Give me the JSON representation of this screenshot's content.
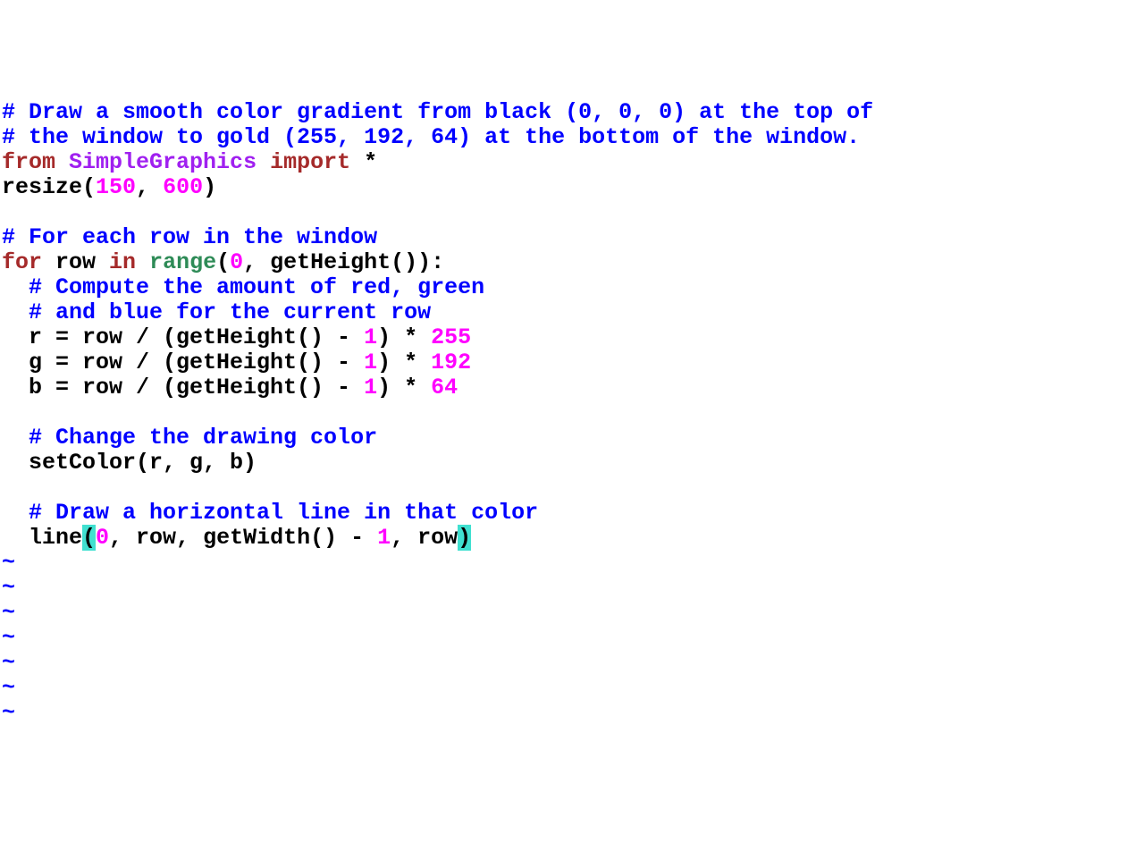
{
  "code": {
    "c1a": "# Draw a smooth color gradient from black (0, 0, 0) at the top of",
    "c1b": "# the window to gold (255, 192, 64) at the bottom of the window.",
    "kw_from": "from",
    "sp": " ",
    "mod": "SimpleGraphics",
    "kw_import": "import",
    "star": " *",
    "resize_txt": "resize(",
    "n150": "150",
    "comma_sp": ", ",
    "n600": "600",
    "close_p": ")",
    "blank": "",
    "c2": "# For each row in the window",
    "kw_for": "for",
    "row_sp": " row ",
    "kw_in": "in",
    "range_txt": "range",
    "open_p": "(",
    "n0": "0",
    "gh_close_colon": ", getHeight()):",
    "c3a": "  # Compute the amount of red, green",
    "c3b": "  # and blue for the current row",
    "r_eq": "  r = row / (getHeight() - ",
    "n1": "1",
    "mid": ") * ",
    "n255": "255",
    "g_eq": "  g = row / (getHeight() - ",
    "n192": "192",
    "b_eq": "  b = row / (getHeight() - ",
    "n64": "64",
    "c4": "  # Change the drawing color",
    "setcolor": "  setColor(r, g, b)",
    "c5": "  # Draw a horizontal line in that color",
    "line_pre": "  line",
    "open_hl": "(",
    "line_mid": ", row, getWidth() - ",
    "row_end": ", row",
    "close_hl": ")",
    "tilde": "~"
  }
}
